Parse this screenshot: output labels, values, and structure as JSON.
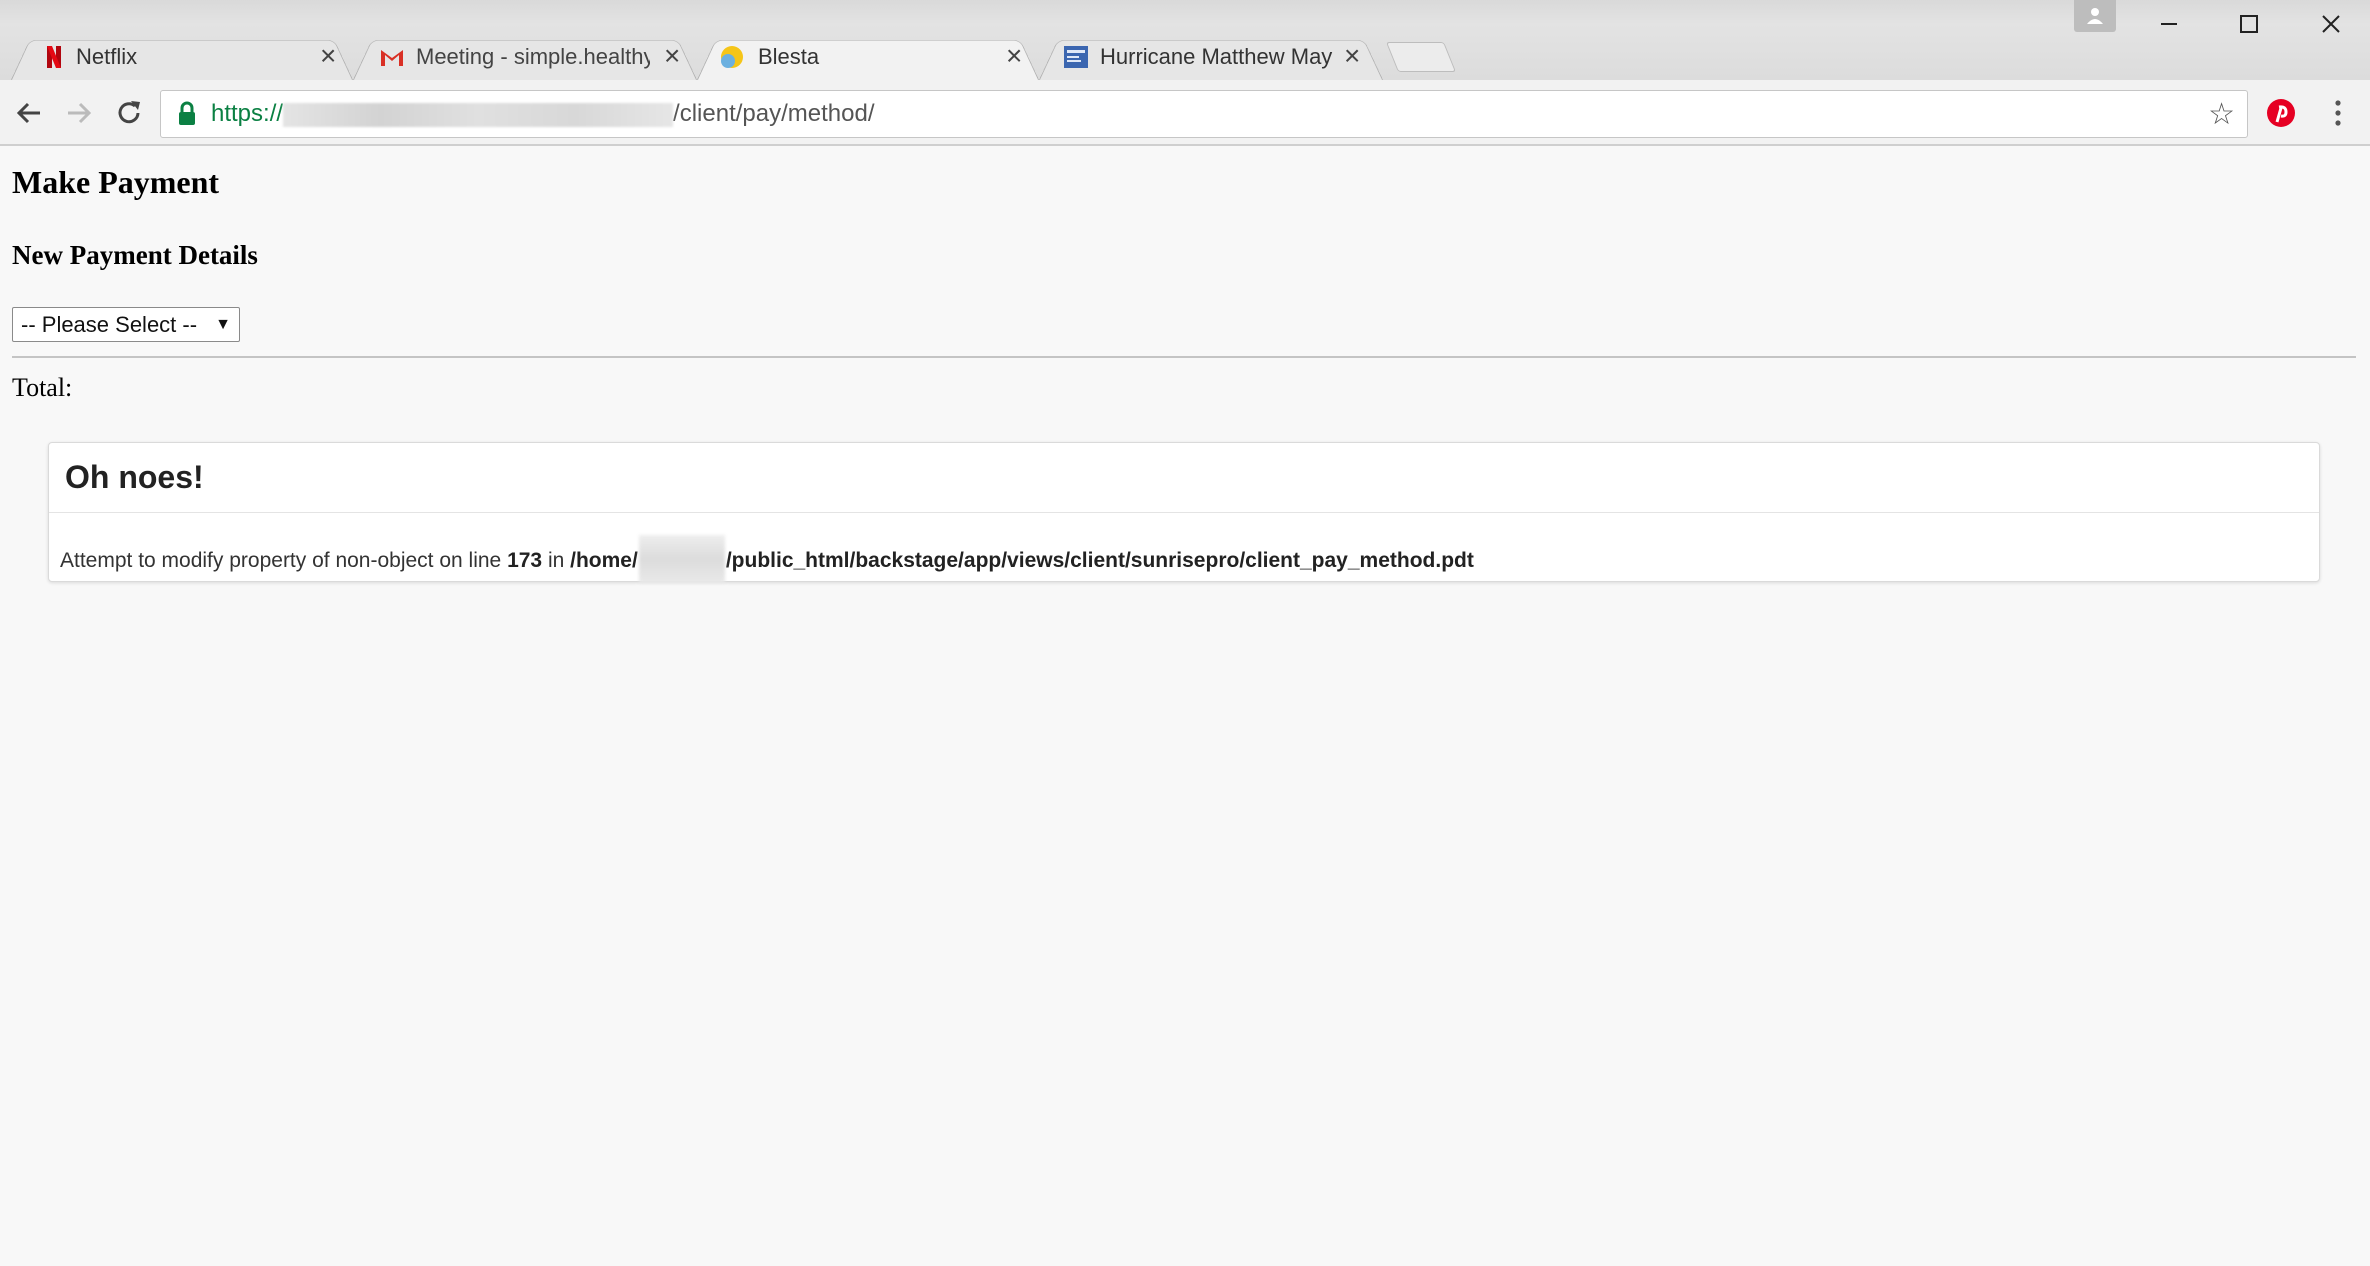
{
  "browser": {
    "tabs": [
      {
        "title": "Netflix",
        "icon": "netflix-icon",
        "active": false
      },
      {
        "title": "Meeting - simple.healthy",
        "icon": "gmail-icon",
        "active": false
      },
      {
        "title": "Blesta",
        "icon": "blesta-icon",
        "active": true
      },
      {
        "title": "Hurricane Matthew May",
        "icon": "news-icon",
        "active": false
      }
    ],
    "address": {
      "scheme": "https://",
      "path": "/client/pay/method/"
    }
  },
  "page": {
    "heading": "Make Payment",
    "subheading": "New Payment Details",
    "select_value": "-- Please Select --",
    "total_label": "Total:"
  },
  "error": {
    "title": "Oh noes!",
    "message_prefix": "Attempt to modify property of non-object on line ",
    "line": "173",
    "in_text": " in ",
    "path_start": "/home/",
    "path_end": "/public_html/backstage/app/views/client/sunrisepro/client_pay_method.pdt"
  },
  "colors": {
    "secure_green": "#0b8043",
    "pinterest_red": "#e60023",
    "netflix_red": "#e50914"
  }
}
